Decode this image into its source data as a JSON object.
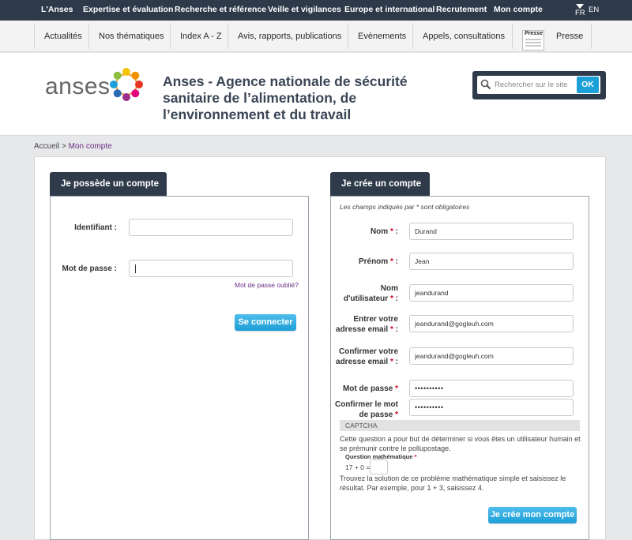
{
  "top_nav": {
    "items": [
      "L'Anses",
      "Expertise et évaluation",
      "Recherche et référence",
      "Veille et vigilances",
      "Europe et international",
      "Recrutement",
      "Mon compte"
    ],
    "lang_current": "FR",
    "lang_other": "EN"
  },
  "sub_nav": {
    "items": [
      "Actualités",
      "Nos thématiques",
      "Index A - Z",
      "Avis, rapports, publications",
      "Evènements",
      "Appels, consultations",
      "Presse"
    ],
    "presse_thumb_label": "Presse"
  },
  "header": {
    "logo": "anses",
    "title": "Anses - Agence nationale de sécurité sanitaire de l’alimentation, de l’environnement et du travail",
    "search_placeholder": "Rechercher sur le site",
    "search_button": "OK"
  },
  "breadcrumb": {
    "home": "Accueil",
    "separator": " > ",
    "current": "Mon compte"
  },
  "login": {
    "tab": "Je possède un compte",
    "username_label": "Identifiant :",
    "username_value": "",
    "password_label": "Mot de passe :",
    "password_value": "",
    "forgot": "Mot de passe oublié?",
    "submit": "Se connecter"
  },
  "register": {
    "tab": "Je crée un compte",
    "required_note": "Les champs indiqués par * sont obligatoires",
    "fields": [
      {
        "label": "Nom",
        "value": "Durand"
      },
      {
        "label": "Prénom",
        "value": "Jean"
      },
      {
        "label_line1": "Nom",
        "label_line2": "d'utilisateur",
        "value": "jeandurand"
      },
      {
        "label_line1": "Entrer votre",
        "label_line2": "adresse email",
        "value": "jeandurand@gogleuh.com"
      },
      {
        "label_line1": "Confirmer votre",
        "label_line2": "adresse email",
        "value": "jeandurand@gogleuh.com"
      },
      {
        "label": "Mot de passe",
        "value": "••••••••••"
      },
      {
        "label_line1": "Confirmer le mot",
        "label_line2": "de passe",
        "value": "••••••••••"
      }
    ],
    "required_mark": "*",
    "required_colon": ":",
    "captcha": {
      "title": "CAPTCHA",
      "description": "Cette question a pour but de déterminer si vous êtes un utilisateur humain et se prémunir contre le pollupostage.",
      "question_label": "Question mathématique",
      "question": "17 + 0 =",
      "answer": "",
      "hint": "Trouvez la solution de ce problème mathématique simple et saisissez le résultat. Par exemple, pour 1 + 3, saisissez 4."
    },
    "submit": "Je crée mon compte"
  },
  "colors": {
    "dark_navy": "#2e3a4a",
    "accent_blue": "#1ba0d8",
    "link_purple": "#6a2c84",
    "required_red": "#d0021b"
  }
}
